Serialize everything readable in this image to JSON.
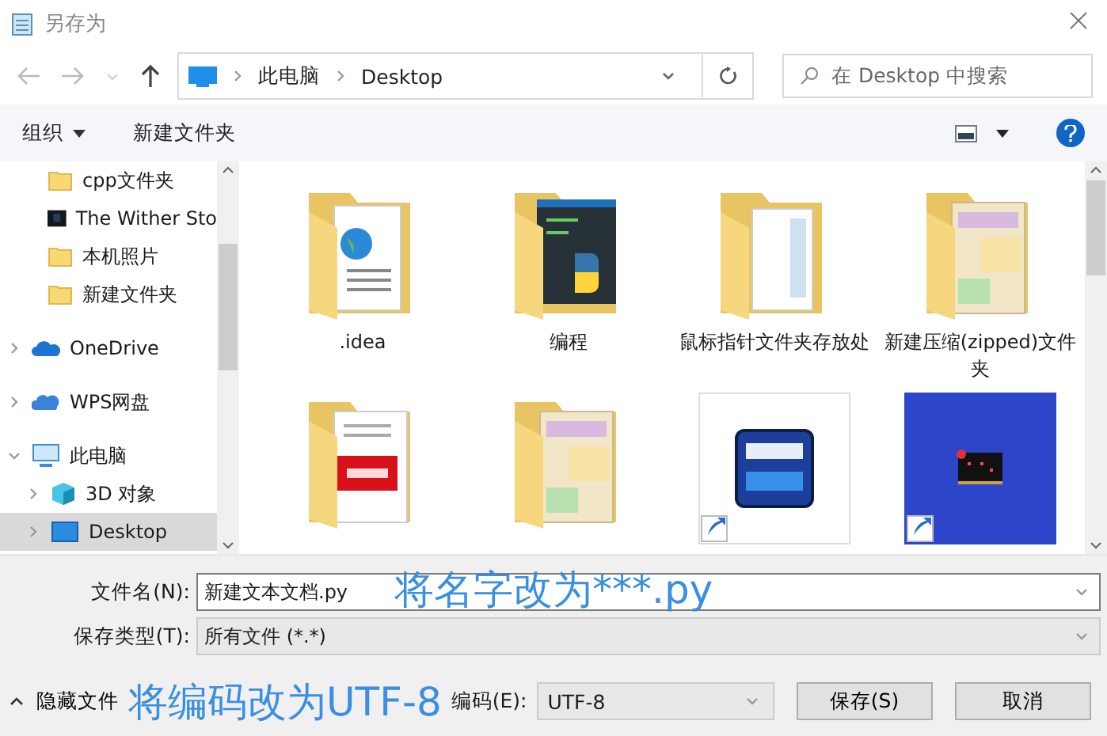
{
  "window": {
    "title": "另存为"
  },
  "nav": {
    "breadcrumb": [
      "此电脑",
      "Desktop"
    ],
    "search": {
      "placeholder": "在 Desktop 中搜索"
    }
  },
  "toolbar": {
    "organize": "组织",
    "new_folder": "新建文件夹"
  },
  "sidebar": {
    "pinned": [
      {
        "label": "cpp文件夹",
        "kind": "folder",
        "selected": false
      },
      {
        "label": "The Wither Sto",
        "kind": "thumbnail",
        "selected": false
      },
      {
        "label": "本机照片",
        "kind": "folder",
        "selected": false
      },
      {
        "label": "新建文件夹",
        "kind": "folder",
        "selected": false
      }
    ],
    "tree": [
      {
        "label": "OneDrive",
        "kind": "onedrive",
        "expanded": false,
        "selected": false
      },
      {
        "label": "WPS网盘",
        "kind": "wps",
        "expanded": false,
        "selected": false
      },
      {
        "label": "此电脑",
        "kind": "pc",
        "expanded": true,
        "selected": false,
        "children": [
          {
            "label": "3D 对象",
            "kind": "cube",
            "expanded": false,
            "selected": false
          },
          {
            "label": "Desktop",
            "kind": "desktop",
            "expanded": false,
            "selected": true
          }
        ]
      }
    ]
  },
  "files": [
    {
      "name": ".idea",
      "kind": "folder-web"
    },
    {
      "name": "编程",
      "kind": "folder-python"
    },
    {
      "name": "鼠标指针文件夹存放处",
      "kind": "folder"
    },
    {
      "name": "新建压缩(zipped)文件夹",
      "kind": "folder-book"
    },
    {
      "kind": "folder-pdf"
    },
    {
      "kind": "folder-book"
    },
    {
      "kind": "shortcut-dev"
    },
    {
      "kind": "shortcut-board"
    }
  ],
  "form": {
    "file_name_label": "文件名(N):",
    "file_name": "新建文本文档.py",
    "type_label": "保存类型(T):",
    "type": "所有文件 (*.*)",
    "hide_folders": "隐藏文件",
    "encoding_label": "编码(E):",
    "encoding": "UTF-8",
    "save": "保存(S)",
    "cancel": "取消"
  },
  "annotations": [
    {
      "text": "将名字改为***.py"
    },
    {
      "text": "将编码改为UTF-8"
    }
  ]
}
